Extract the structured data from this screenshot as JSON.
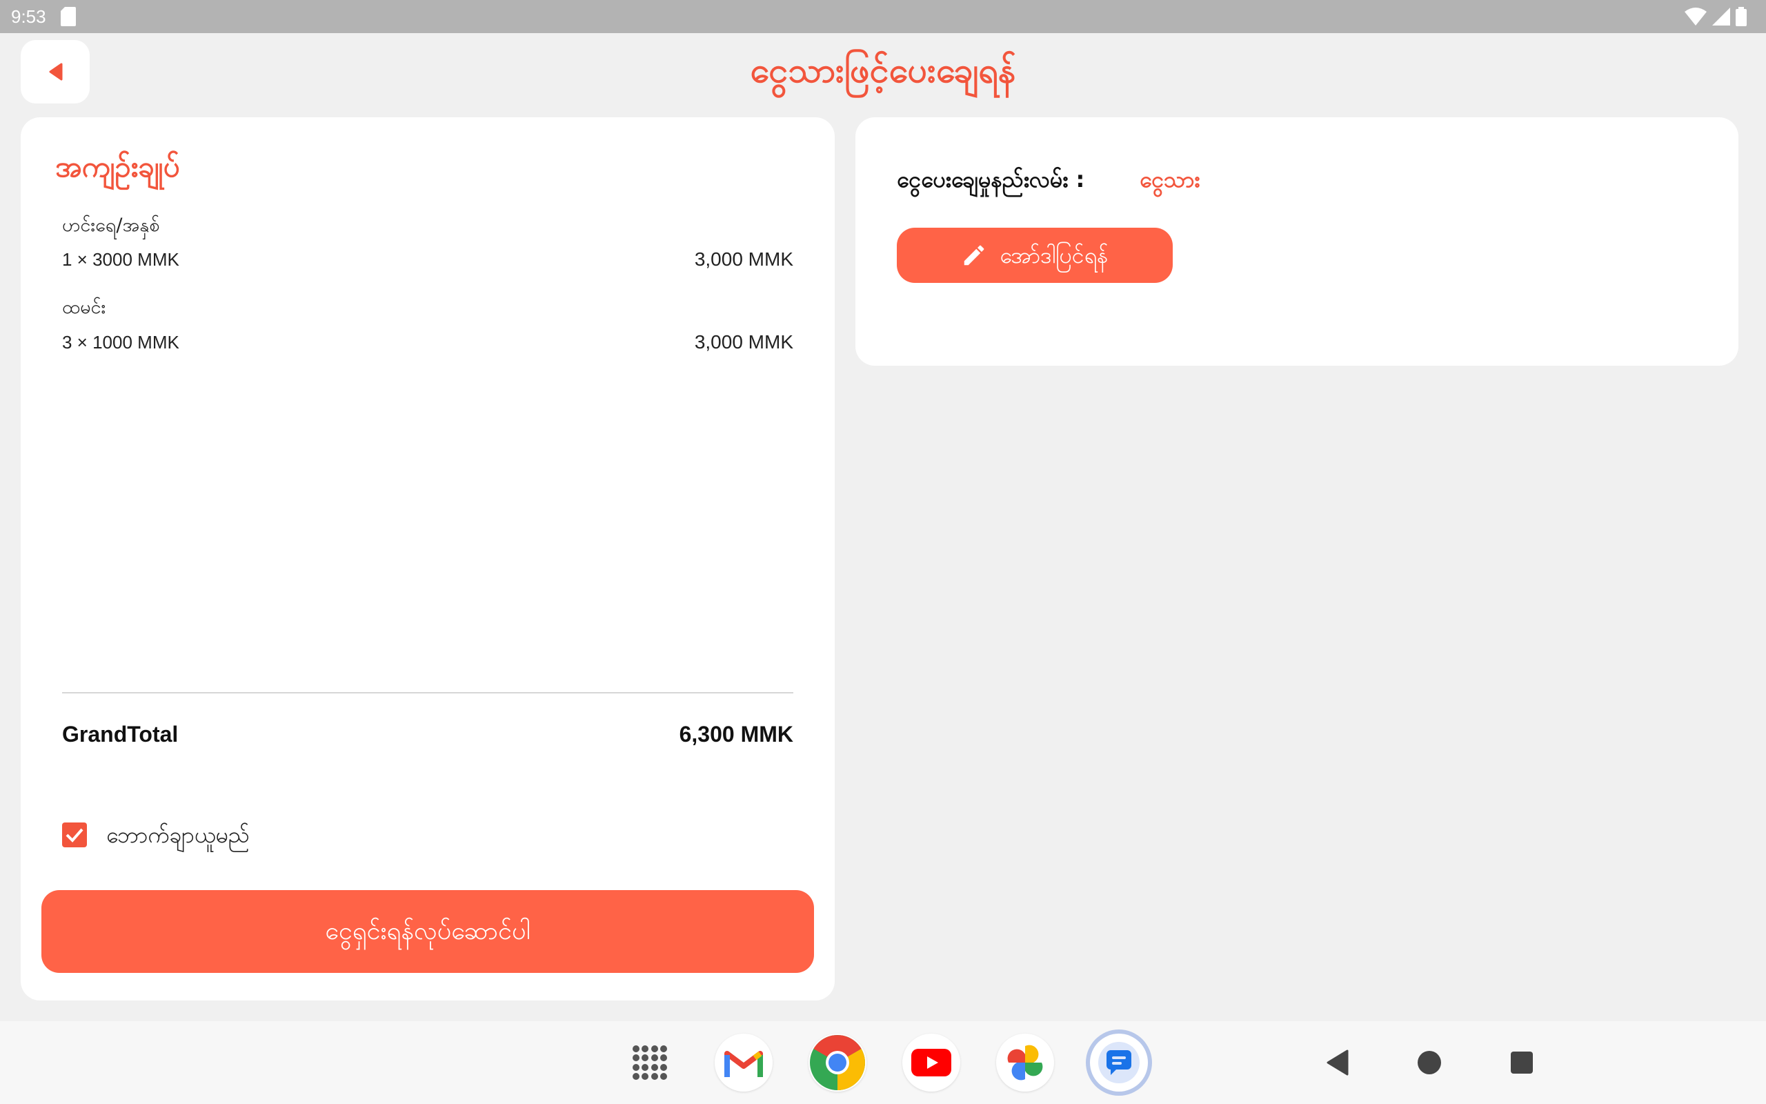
{
  "status": {
    "time": "9:53"
  },
  "header": {
    "title": "ငွေသားဖြင့်ပေးချေရန်"
  },
  "summary": {
    "title": "အကျဉ်းချုပ်",
    "items": [
      {
        "name": "ဟင်းရေ/အနှစ်",
        "qty_line": "1 × 3000 MMK",
        "amount": "3,000 MMK"
      },
      {
        "name": "ထမင်း",
        "qty_line": "3 × 1000 MMK",
        "amount": "3,000 MMK"
      }
    ],
    "grand_total_label": "GrandTotal",
    "grand_total_value": "6,300 MMK",
    "takeaway_label": "ဘောက်ချာယူမည်",
    "takeaway_checked": true,
    "submit_label": "ငွေရှင်းရန်လုပ်ဆောင်ပါ"
  },
  "payment": {
    "method_label": "ငွေပေးချေမှုနည်းလမ်း :",
    "method_value": "ငွေသား",
    "edit_label": "အော်ဒါပြင်ရန်"
  },
  "colors": {
    "accent": "#ff6347",
    "accent_text": "#f2553c",
    "background": "#f0f0f0"
  },
  "dock_icons": [
    "app-drawer-icon",
    "gmail-icon",
    "chrome-icon",
    "youtube-icon",
    "photos-icon",
    "messages-icon"
  ],
  "nav_icons": [
    "back-icon",
    "home-icon",
    "recents-icon"
  ]
}
